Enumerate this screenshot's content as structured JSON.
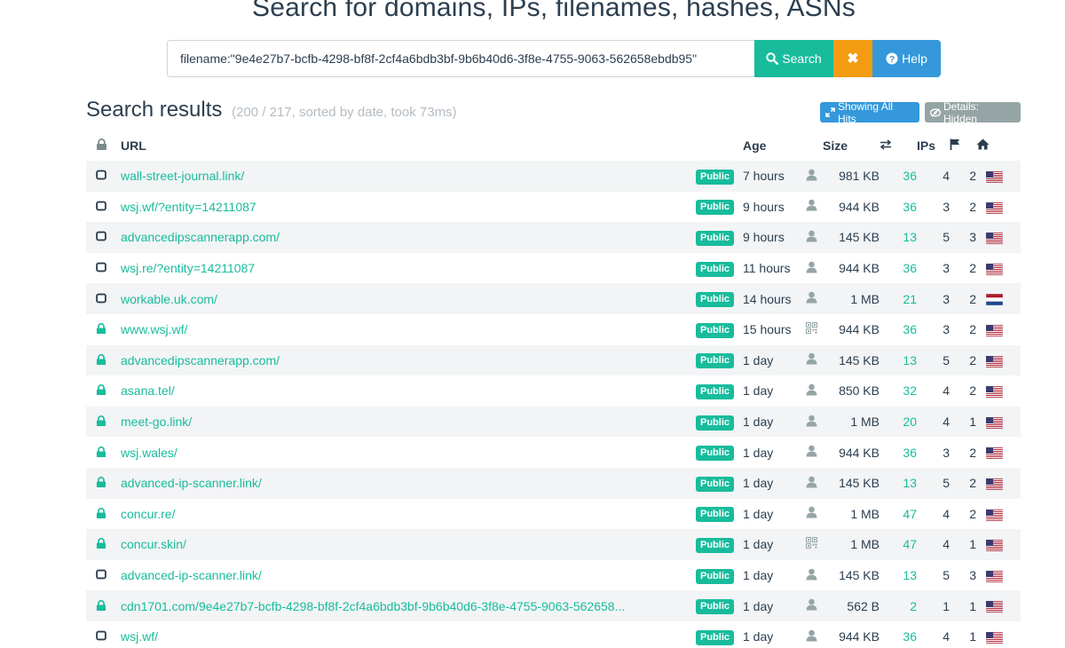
{
  "header": {
    "title": "Search for domains, IPs, filenames, hashes, ASNs"
  },
  "search": {
    "value": "filename:\"9e4e27b7-bcfb-4298-bf8f-2cf4a6bdb3bf-9b6b40d6-3f8e-4755-9063-562658ebdb95\"",
    "search_label": "Search",
    "clear_label": "✖",
    "help_label": "Help"
  },
  "results": {
    "title": "Search results",
    "meta": "(200 / 217, sorted by date, took 73ms)",
    "showing_all_hits": "Showing All Hits",
    "details_hidden": "Details: Hidden",
    "columns": {
      "url": "URL",
      "age": "Age",
      "size": "Size",
      "ips": "IPs"
    },
    "rows": [
      {
        "secure": false,
        "url": "wall-street-journal.link/",
        "badge": "Public",
        "age": "7 hours",
        "submitter": "user",
        "size": "981 KB",
        "links": "36",
        "ips": "4",
        "flags": "2",
        "country": "us"
      },
      {
        "secure": false,
        "url": "wsj.wf/?entity=14211087",
        "badge": "Public",
        "age": "9 hours",
        "submitter": "user",
        "size": "944 KB",
        "links": "36",
        "ips": "3",
        "flags": "2",
        "country": "us"
      },
      {
        "secure": false,
        "url": "advancedipscannerapp.com/",
        "badge": "Public",
        "age": "9 hours",
        "submitter": "user",
        "size": "145 KB",
        "links": "13",
        "ips": "5",
        "flags": "3",
        "country": "us"
      },
      {
        "secure": false,
        "url": "wsj.re/?entity=14211087",
        "badge": "Public",
        "age": "11 hours",
        "submitter": "user",
        "size": "944 KB",
        "links": "36",
        "ips": "3",
        "flags": "2",
        "country": "us"
      },
      {
        "secure": false,
        "url": "workable.uk.com/",
        "badge": "Public",
        "age": "14 hours",
        "submitter": "user",
        "size": "1 MB",
        "links": "21",
        "ips": "3",
        "flags": "2",
        "country": "nl"
      },
      {
        "secure": true,
        "url": "www.wsj.wf/",
        "badge": "Public",
        "age": "15 hours",
        "submitter": "qr",
        "size": "944 KB",
        "links": "36",
        "ips": "3",
        "flags": "2",
        "country": "us"
      },
      {
        "secure": true,
        "url": "advancedipscannerapp.com/",
        "badge": "Public",
        "age": "1 day",
        "submitter": "user",
        "size": "145 KB",
        "links": "13",
        "ips": "5",
        "flags": "2",
        "country": "us"
      },
      {
        "secure": true,
        "url": "asana.tel/",
        "badge": "Public",
        "age": "1 day",
        "submitter": "user",
        "size": "850 KB",
        "links": "32",
        "ips": "4",
        "flags": "2",
        "country": "us"
      },
      {
        "secure": true,
        "url": "meet-go.link/",
        "badge": "Public",
        "age": "1 day",
        "submitter": "user",
        "size": "1 MB",
        "links": "20",
        "ips": "4",
        "flags": "1",
        "country": "us"
      },
      {
        "secure": true,
        "url": "wsj.wales/",
        "badge": "Public",
        "age": "1 day",
        "submitter": "user",
        "size": "944 KB",
        "links": "36",
        "ips": "3",
        "flags": "2",
        "country": "us"
      },
      {
        "secure": true,
        "url": "advanced-ip-scanner.link/",
        "badge": "Public",
        "age": "1 day",
        "submitter": "user",
        "size": "145 KB",
        "links": "13",
        "ips": "5",
        "flags": "2",
        "country": "us"
      },
      {
        "secure": true,
        "url": "concur.re/",
        "badge": "Public",
        "age": "1 day",
        "submitter": "user",
        "size": "1 MB",
        "links": "47",
        "ips": "4",
        "flags": "2",
        "country": "us"
      },
      {
        "secure": true,
        "url": "concur.skin/",
        "badge": "Public",
        "age": "1 day",
        "submitter": "qr",
        "size": "1 MB",
        "links": "47",
        "ips": "4",
        "flags": "1",
        "country": "us"
      },
      {
        "secure": false,
        "url": "advanced-ip-scanner.link/",
        "badge": "Public",
        "age": "1 day",
        "submitter": "user",
        "size": "145 KB",
        "links": "13",
        "ips": "5",
        "flags": "3",
        "country": "us"
      },
      {
        "secure": true,
        "url": "cdn1701.com/9e4e27b7-bcfb-4298-bf8f-2cf4a6bdb3bf-9b6b40d6-3f8e-4755-9063-562658...",
        "badge": "Public",
        "age": "1 day",
        "submitter": "user",
        "size": "562 B",
        "links": "2",
        "ips": "1",
        "flags": "1",
        "country": "us"
      },
      {
        "secure": false,
        "url": "wsj.wf/",
        "badge": "Public",
        "age": "1 day",
        "submitter": "user",
        "size": "944 KB",
        "links": "36",
        "ips": "4",
        "flags": "1",
        "country": "us"
      }
    ]
  },
  "colors": {
    "accent": "#18bc9c",
    "warning": "#f39c12",
    "info": "#3498db",
    "muted": "#95a5a6",
    "text": "#2c3e50"
  }
}
